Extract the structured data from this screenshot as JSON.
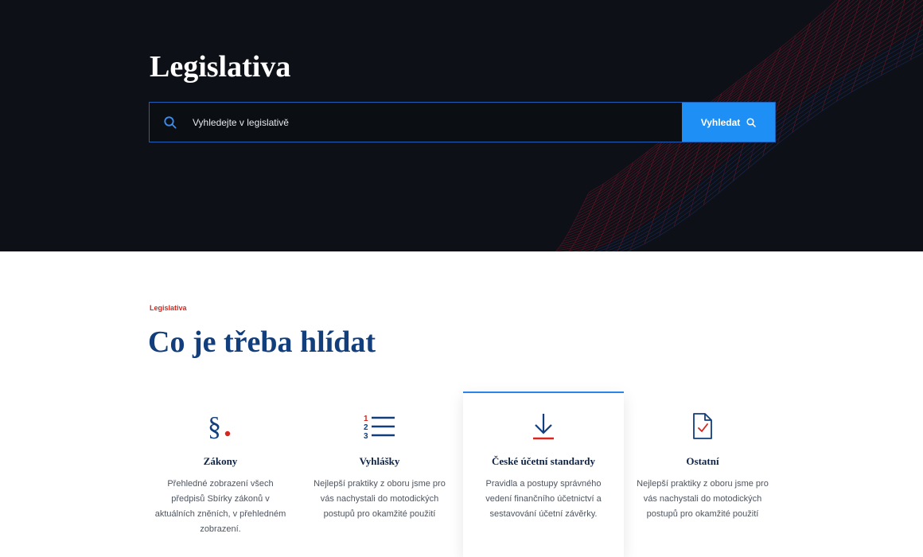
{
  "hero": {
    "title": "Legislativa",
    "search": {
      "placeholder": "Vyhledejte v legislativě",
      "button_label": "Vyhledat"
    }
  },
  "section": {
    "eyebrow": "Legislativa",
    "title": "Co je třeba hlídat"
  },
  "cards": [
    {
      "icon": "paragraph-icon",
      "title": "Zákony",
      "description": "Přehledné zobrazení všech předpisů Sbírky zákonů v aktuálních zněních, v přehledném zobrazení."
    },
    {
      "icon": "numbered-list-icon",
      "title": "Vyhlášky",
      "description": "Nejlepší praktiky z oboru jsme pro vás nachystali do motodických postupů pro okamžité použití"
    },
    {
      "icon": "download-arrow-icon",
      "title": "České účetní standardy",
      "description": "Pravidla a  postupy správného vedení finančního účetnictví a sestavování účetní závěrky.",
      "active": true
    },
    {
      "icon": "document-check-icon",
      "title": "Ostatní",
      "description": "Nejlepší praktiky z oboru jsme pro vás nachystali do motodických postupů pro okamžité použití"
    }
  ],
  "colors": {
    "hero_bg": "#0d1117",
    "accent_blue": "#1e8ff5",
    "accent_red": "#d7261e",
    "title_navy": "#123e7c"
  }
}
